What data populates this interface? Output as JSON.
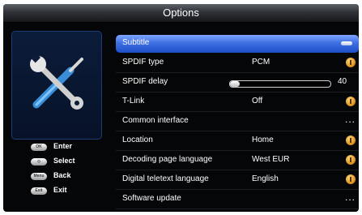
{
  "window": {
    "title": "Options"
  },
  "legend": [
    {
      "key": "OK",
      "label": "Enter"
    },
    {
      "key": "◇",
      "label": "Select"
    },
    {
      "key": "Menu",
      "label": "Back"
    },
    {
      "key": "Exit",
      "label": "Exit"
    }
  ],
  "menu": {
    "items": [
      {
        "label": "Subtitle",
        "value": "",
        "indicator": "selection-pill"
      },
      {
        "label": "SPDIF type",
        "value": "PCM",
        "indicator": "info-icon"
      },
      {
        "label": "SPDIF delay",
        "value": "40",
        "slider_fraction": 0.1,
        "indicator": "slider"
      },
      {
        "label": "T-Link",
        "value": "Off",
        "indicator": "info-icon"
      },
      {
        "label": "Common interface",
        "value": "",
        "more": "...",
        "indicator": "more-dots"
      },
      {
        "label": "Location",
        "value": "Home",
        "indicator": "info-icon"
      },
      {
        "label": "Decoding page language",
        "value": "West EUR",
        "indicator": "info-icon"
      },
      {
        "label": "Digital teletext language",
        "value": "English",
        "indicator": "info-icon"
      },
      {
        "label": "Software update",
        "value": "",
        "more": "...",
        "indicator": "more-dots"
      }
    ]
  },
  "colors": {
    "accent": "#3f6fe2",
    "panel": "#0b1c3a",
    "info": "#e2a02a",
    "background": "#050608"
  }
}
